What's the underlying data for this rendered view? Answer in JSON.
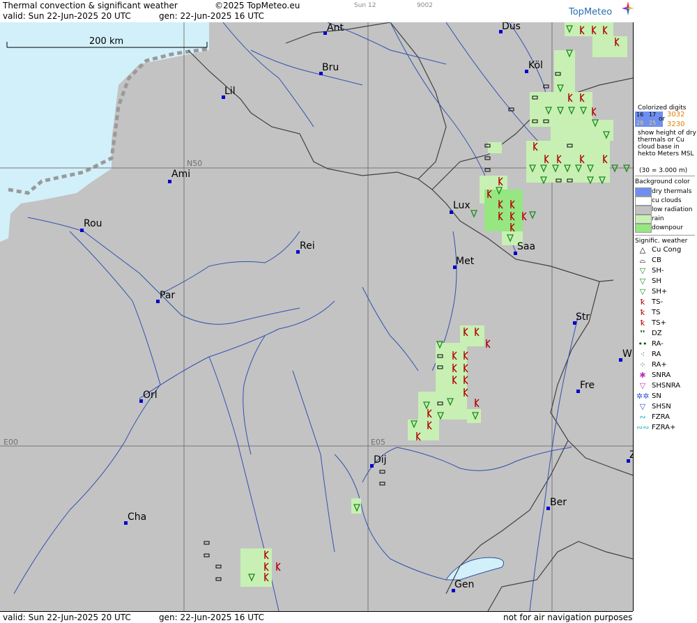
{
  "header": {
    "title": "Thermal convection & significant weather",
    "copyright": "©2025 TopMeteo.eu",
    "level_a": "Sun 12",
    "level_b": "9002",
    "valid": "valid:  Sun  22-Jun-2025  20 UTC",
    "gen": "gen: 22-Jun-2025 16 UTC"
  },
  "footer": {
    "valid": "valid:  Sun  22-Jun-2025  20 UTC",
    "gen": "gen: 22-Jun-2025 16 UTC",
    "notice": "not for air navigation purposes"
  },
  "logo": "TopMeteo",
  "scale_label": "200 km",
  "grid_labels": {
    "n50": "N50",
    "e00": "E00",
    "e05": "E05"
  },
  "cities": [
    {
      "name": "Ant"
    },
    {
      "name": "Düs"
    },
    {
      "name": "Köl"
    },
    {
      "name": "Bru"
    },
    {
      "name": "Lil"
    },
    {
      "name": "Ami"
    },
    {
      "name": "Rou"
    },
    {
      "name": "Lux"
    },
    {
      "name": "Rei"
    },
    {
      "name": "Saa"
    },
    {
      "name": "Met"
    },
    {
      "name": "Par"
    },
    {
      "name": "Str"
    },
    {
      "name": "W"
    },
    {
      "name": "Fre"
    },
    {
      "name": "Orl"
    },
    {
      "name": "Dij"
    },
    {
      "name": "Z"
    },
    {
      "name": "Ber"
    },
    {
      "name": "Cha"
    },
    {
      "name": "Gen"
    }
  ],
  "legend": {
    "colorized_title": "Colorized digits",
    "digits_a": "16",
    "digits_b": "17",
    "digits_c": "28",
    "digits_d": "25",
    "or": "or",
    "digits_e": "3032",
    "digits_f": "3230",
    "desc": "show height of dry thermals or Cu cloud base in hekto Meters MSL",
    "example": "(30 = 3.000 m)",
    "bg_title": "Background color",
    "bg_items": [
      {
        "label": "dry thermals",
        "color": "#6f8ff0"
      },
      {
        "label": "cu clouds",
        "color": "#ffffff"
      },
      {
        "label": "low radiation",
        "color": "#c3c3c3"
      },
      {
        "label": "rain",
        "color": "#c8f0b4"
      },
      {
        "label": "downpour",
        "color": "#96e682"
      }
    ],
    "sig_title": "Signific. weather",
    "sig_items": [
      {
        "label": "Cu Cong",
        "icon": "cu-cong-icon",
        "glyph": "△",
        "color": "#000000"
      },
      {
        "label": "CB",
        "icon": "cb-icon",
        "glyph": "⌓",
        "color": "#000000"
      },
      {
        "label": "SH-",
        "icon": "shower-light-icon",
        "glyph": "▽",
        "color": "#1a8a1a"
      },
      {
        "label": "SH",
        "icon": "shower-icon",
        "glyph": "▽",
        "color": "#1a8a1a"
      },
      {
        "label": "SH+",
        "icon": "shower-heavy-icon",
        "glyph": "▽",
        "color": "#1a8a1a"
      },
      {
        "label": "TS-",
        "icon": "thunderstorm-light-icon",
        "glyph": "ꝁ",
        "color": "#b00000"
      },
      {
        "label": "TS",
        "icon": "thunderstorm-icon",
        "glyph": "ꝁ",
        "color": "#b00000"
      },
      {
        "label": "TS+",
        "icon": "thunderstorm-heavy-icon",
        "glyph": "ꝁ",
        "color": "#b00000"
      },
      {
        "label": "DZ",
        "icon": "drizzle-icon",
        "glyph": "❜❜",
        "color": "#1a6a1a"
      },
      {
        "label": "RA-",
        "icon": "rain-light-icon",
        "glyph": "••",
        "color": "#0a4a0a"
      },
      {
        "label": "RA",
        "icon": "rain-icon",
        "glyph": "⁖",
        "color": "#0a4a0a"
      },
      {
        "label": "RA+",
        "icon": "rain-heavy-icon",
        "glyph": "⁘",
        "color": "#0a4a0a"
      },
      {
        "label": "SNRA",
        "icon": "snow-rain-icon",
        "glyph": "✱",
        "color": "#c030c0"
      },
      {
        "label": "SHSNRA",
        "icon": "snow-rain-shower-icon",
        "glyph": "▽",
        "color": "#c030c0"
      },
      {
        "label": "SN",
        "icon": "snow-icon",
        "glyph": "✲✲",
        "color": "#3050d0"
      },
      {
        "label": "SHSN",
        "icon": "snow-shower-icon",
        "glyph": "▽",
        "color": "#3050d0"
      },
      {
        "label": "FZRA",
        "icon": "freezing-rain-icon",
        "glyph": "∾",
        "color": "#20b0c0"
      },
      {
        "label": "FZRA+",
        "icon": "freezing-rain-heavy-icon",
        "glyph": "∾∾",
        "color": "#20b0c0"
      }
    ]
  }
}
